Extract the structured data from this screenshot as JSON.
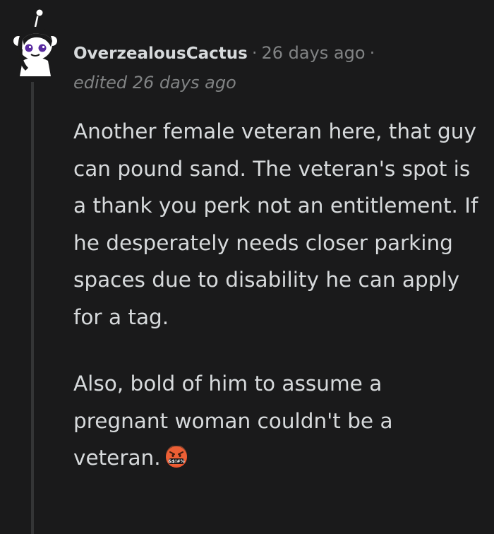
{
  "comment": {
    "author": "OverzealousCactus",
    "separator": "·",
    "timestamp": "26 days ago",
    "edited": "edited 26 days ago",
    "paragraphs": [
      "Another female veteran here, that guy can pound sand. The veteran's spot is a thank you perk not an entitlement. If he desperately needs closer parking spaces due to disability he can apply for a tag.",
      "Also, bold of him to assume a pregnant woman couldn't be a veteran."
    ],
    "emoji": {
      "name": "angry-cursing-face",
      "label": "&$!#%"
    }
  },
  "avatar": {
    "name": "snoo-avatar-icon"
  },
  "colors": {
    "background": "#1a1a1b",
    "text": "#d7dadc",
    "meta": "#818384",
    "thread_line": "#343536",
    "emoji": "#e8542e"
  }
}
